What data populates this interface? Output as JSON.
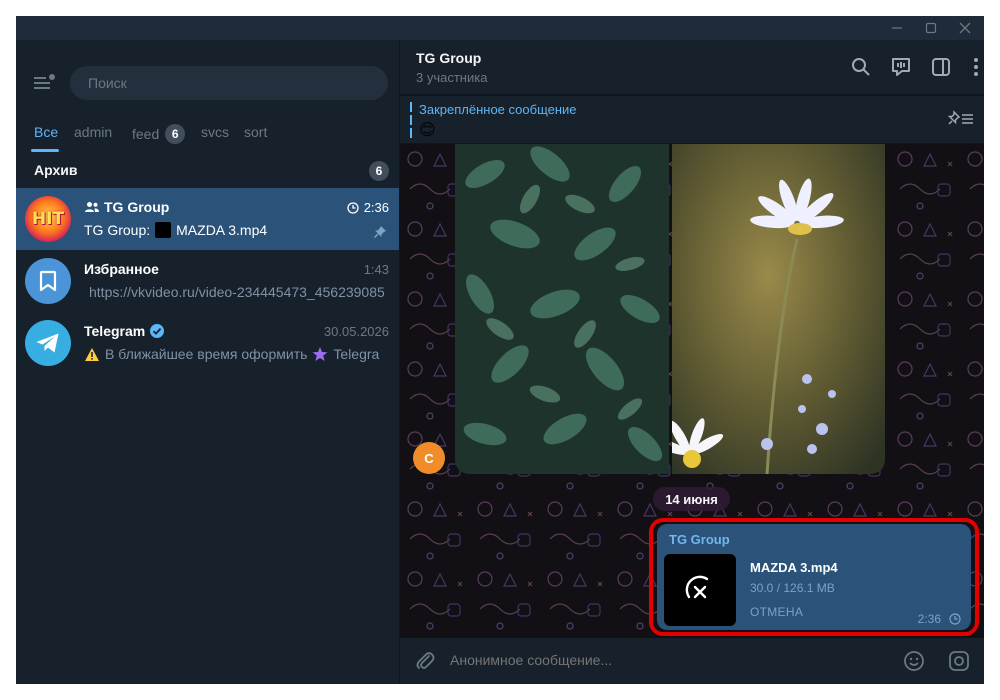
{
  "sidebar": {
    "search_placeholder": "Поиск",
    "folders": [
      {
        "label": "Все",
        "badge": null
      },
      {
        "label": "admin",
        "badge": null
      },
      {
        "label": "feed",
        "badge": "6"
      },
      {
        "label": "svcs",
        "badge": null
      },
      {
        "label": "sort",
        "badge": null
      }
    ],
    "archive": {
      "label": "Архив",
      "badge": "6"
    },
    "chats": [
      {
        "name": "TG Group",
        "time": "2:36",
        "preview_prefix": "TG Group:",
        "preview": "MAZDA 3.mp4",
        "avatar_text": "HIT"
      },
      {
        "name": "Избранное",
        "time": "1:43",
        "preview": "https://vkvideo.ru/video-234445473_456239085"
      },
      {
        "name": "Telegram",
        "time": "30.05.2026",
        "preview": "В ближайшее время оформить",
        "preview_suffix": "Telegra"
      }
    ]
  },
  "chat": {
    "title": "TG Group",
    "subtitle": "3 участника",
    "pinned": {
      "title": "Закреплённое сообщение",
      "emoji": "😊"
    },
    "sender_avatar": "С",
    "date": "14 июня",
    "message": {
      "sender": "TG Group",
      "file_name": "MAZDA 3.mp4",
      "file_size": "30.0 / 126.1 MB",
      "cancel_label": "ОТМЕНА",
      "time": "2:36"
    },
    "composer_placeholder": "Анонимное сообщение..."
  },
  "colors": {
    "accent": "#5eb5f7",
    "selected": "#2b5278",
    "highlight": "#e30000"
  }
}
